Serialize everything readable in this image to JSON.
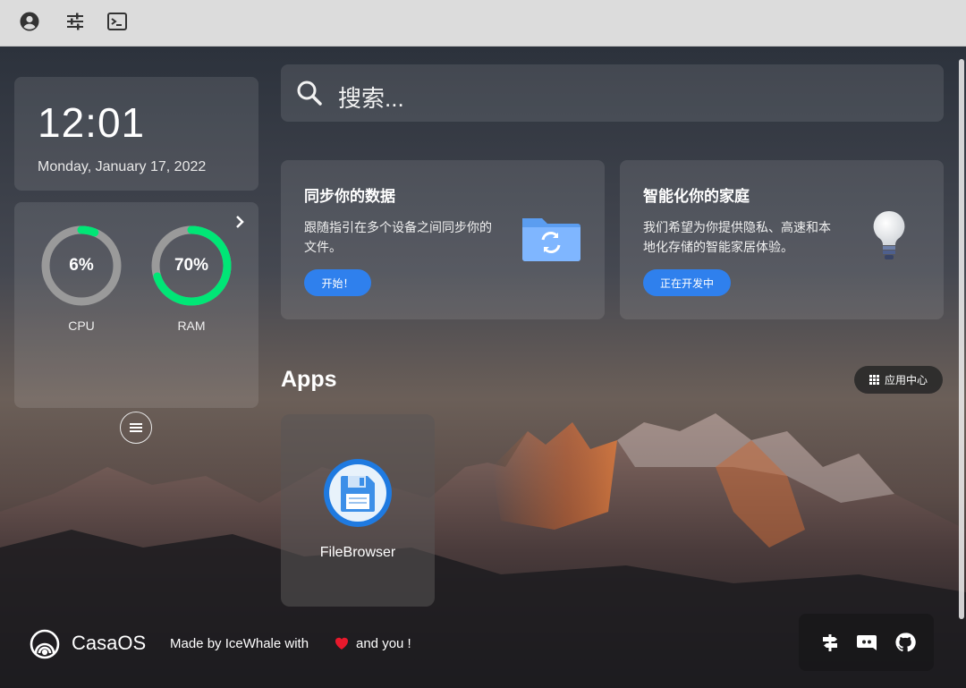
{
  "topbar": {
    "icons": [
      "account-icon",
      "sliders-icon",
      "terminal-icon"
    ]
  },
  "clock": {
    "time": "12:01",
    "date": "Monday, January 17, 2022"
  },
  "system": {
    "cpu": {
      "label": "CPU",
      "value_text": "6%",
      "percent": 6,
      "color": "#00e676"
    },
    "ram": {
      "label": "RAM",
      "value_text": "70%",
      "percent": 70,
      "color": "#00e676"
    }
  },
  "search": {
    "placeholder": "搜索..."
  },
  "cards": [
    {
      "title": "同步你的数据",
      "desc_line1": "跟随指引在多个设备之间同步你的",
      "desc_line2": "文件。",
      "button": "开始！"
    },
    {
      "title": "智能化你的家庭",
      "desc_line1": "我们希望为你提供隐私、高速和本",
      "desc_line2": "地化存储的智能家居体验。",
      "button": "正在开发中"
    }
  ],
  "apps": {
    "title": "Apps",
    "app_center": "应用中心",
    "items": [
      {
        "name": "FileBrowser"
      }
    ]
  },
  "footer": {
    "brand": "CasaOS",
    "made_by": "Made by IceWhale with",
    "and_you": "and you !",
    "heart_color": "#e8192c"
  },
  "colors": {
    "accent": "#2f80ed",
    "gauge_track": "#9a9a9a"
  }
}
